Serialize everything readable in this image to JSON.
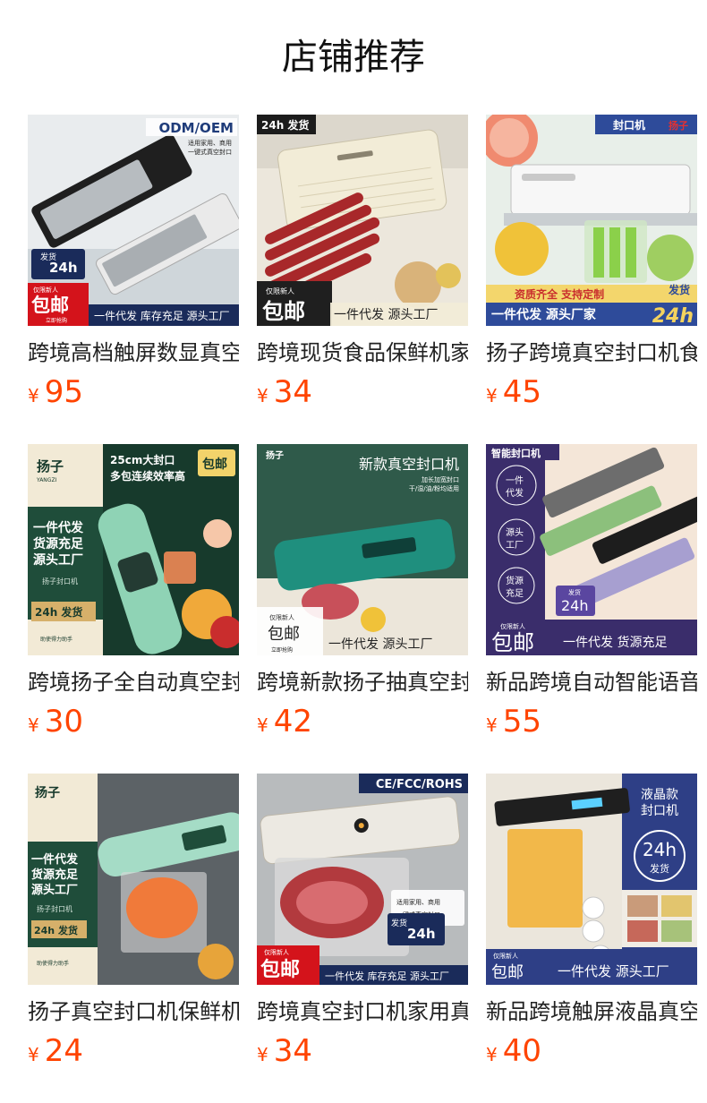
{
  "section_title": "店铺推荐",
  "colors": {
    "price": "#ff4400",
    "title": "#111111",
    "text": "#222222"
  },
  "products": [
    {
      "name": "跨境高档触屏数显真空",
      "currency": "¥",
      "price": "95",
      "image": {
        "corner_tag": "ODM/OEM",
        "sub_tag_1": "适用家用、商用",
        "sub_tag_2": "一键式真空封口",
        "ship_tag_1": "发货",
        "ship_tag_2": "24h",
        "promo_1": "仅限新人",
        "promo_2": "包邮",
        "promo_3": "立即抢购",
        "footer": "一件代发 库存充足 源头工厂"
      }
    },
    {
      "name": "跨境现货食品保鲜机家",
      "currency": "¥",
      "price": "34",
      "image": {
        "corner_tag": "24h 发货",
        "promo_1": "仅限新人",
        "promo_2": "包邮",
        "footer": "一件代发 源头工厂"
      }
    },
    {
      "name": "扬子跨境真空封口机食",
      "currency": "¥",
      "price": "45",
      "image": {
        "corner_tag": "封口机",
        "brand": "扬子",
        "tagline": "资质齐全 支持定制",
        "ship_tag": "发货",
        "footer_left": "一件代发 源头厂家",
        "footer_right": "24h"
      }
    },
    {
      "name": "跨境扬子全自动真空封",
      "currency": "¥",
      "price": "30",
      "image": {
        "brand": "扬子",
        "brand_sub": "YANGZI",
        "headline_1": "25cm大封口",
        "headline_2": "多包连续效率高",
        "badge": "包邮",
        "side_1": "一件代发",
        "side_2": "货源充足",
        "side_3": "源头工厂",
        "side_4": "扬子封口机",
        "ship": "24h 发货",
        "small_note": "助使得力助手"
      }
    },
    {
      "name": "跨境新款扬子抽真空封",
      "currency": "¥",
      "price": "42",
      "image": {
        "brand": "扬子",
        "headline": "新款真空封口机",
        "sub_1": "加长加宽封口",
        "sub_2": "干/湿/油/粉均适用",
        "promo_1": "仅限新人",
        "promo_2": "包邮",
        "promo_3": "立即抢购",
        "footer": "一件代发 源头工厂"
      }
    },
    {
      "name": "新品跨境自动智能语音",
      "currency": "¥",
      "price": "55",
      "image": {
        "corner_tag": "智能封口机",
        "circle_1_a": "一件",
        "circle_1_b": "代发",
        "circle_2_a": "源头",
        "circle_2_b": "工厂",
        "circle_3_a": "货源",
        "circle_3_b": "充足",
        "ship_small": "发货",
        "ship_big": "24h",
        "promo_1": "仅限新人",
        "promo_2": "包邮",
        "footer": "一件代发 货源充足"
      }
    },
    {
      "name": "扬子真空封口机保鲜机",
      "currency": "¥",
      "price": "24",
      "image": {
        "brand": "扬子",
        "side_1": "一件代发",
        "side_2": "货源充足",
        "side_3": "源头工厂",
        "side_4": "扬子封口机",
        "ship": "24h 发货",
        "small_note": "助使得力助手"
      }
    },
    {
      "name": "跨境真空封口机家用真",
      "currency": "¥",
      "price": "34",
      "image": {
        "corner_tag": "CE/FCC/ROHS",
        "sub_tag_1": "适用家用、商用",
        "sub_tag_2": "一键式真空封口",
        "ship_tag_1": "发货",
        "ship_tag_2": "24h",
        "promo_1": "仅限新人",
        "promo_2": "包邮",
        "footer": "一件代发 库存充足 源头工厂"
      }
    },
    {
      "name": "新品跨境触屏液晶真空",
      "currency": "¥",
      "price": "40",
      "image": {
        "headline_1": "液晶款",
        "headline_2": "封口机",
        "ship_big": "24h",
        "ship_small": "发货",
        "promo_1": "仅限新人",
        "promo_2": "包邮",
        "footer": "一件代发 源头工厂"
      }
    }
  ]
}
